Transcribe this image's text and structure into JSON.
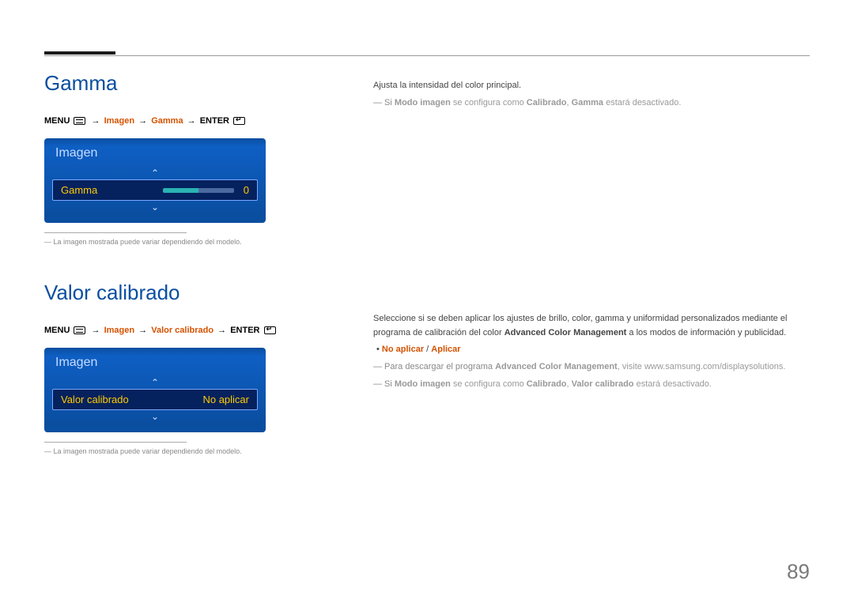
{
  "page_number": "89",
  "section1": {
    "title": "Gamma",
    "breadcrumb": {
      "menu": "MENU",
      "steps": [
        "Imagen",
        "Gamma"
      ],
      "enter": "ENTER"
    },
    "osd": {
      "panel_title": "Imagen",
      "row_label": "Gamma",
      "row_value": "0"
    },
    "footnote": "La imagen mostrada puede variar dependiendo del modelo.",
    "right": {
      "intro": "Ajusta la intensidad del color principal.",
      "note_prefix": "―  Si ",
      "note_b1": "Modo imagen",
      "note_mid1": " se configura como ",
      "note_b2": "Calibrado",
      "note_sep": ", ",
      "note_b3": "Gamma",
      "note_tail": " estará desactivado."
    }
  },
  "section2": {
    "title": "Valor calibrado",
    "breadcrumb": {
      "menu": "MENU",
      "steps": [
        "Imagen",
        "Valor calibrado"
      ],
      "enter": "ENTER"
    },
    "osd": {
      "panel_title": "Imagen",
      "row_label": "Valor calibrado",
      "row_value": "No aplicar"
    },
    "footnote": "La imagen mostrada puede variar dependiendo del modelo.",
    "right": {
      "p1a": "Seleccione si se deben aplicar los ajustes de brillo, color, gamma y uniformidad personalizados mediante el programa de calibración del color ",
      "p1b": "Advanced Color Management",
      "p1c": " a los modos de información y publicidad.",
      "opt_bullet": "•   ",
      "opt1": "No aplicar",
      "opt_sep": " / ",
      "opt2": "Aplicar",
      "n1_pre": "―  Para descargar el programa ",
      "n1_b": "Advanced Color Management",
      "n1_post": ", visite www.samsung.com/displaysolutions.",
      "n2_pre": "―  Si ",
      "n2_b1": "Modo imagen",
      "n2_mid1": " se configura como ",
      "n2_b2": "Calibrado",
      "n2_sep": ", ",
      "n2_b3": "Valor calibrado",
      "n2_tail": " estará desactivado."
    }
  }
}
